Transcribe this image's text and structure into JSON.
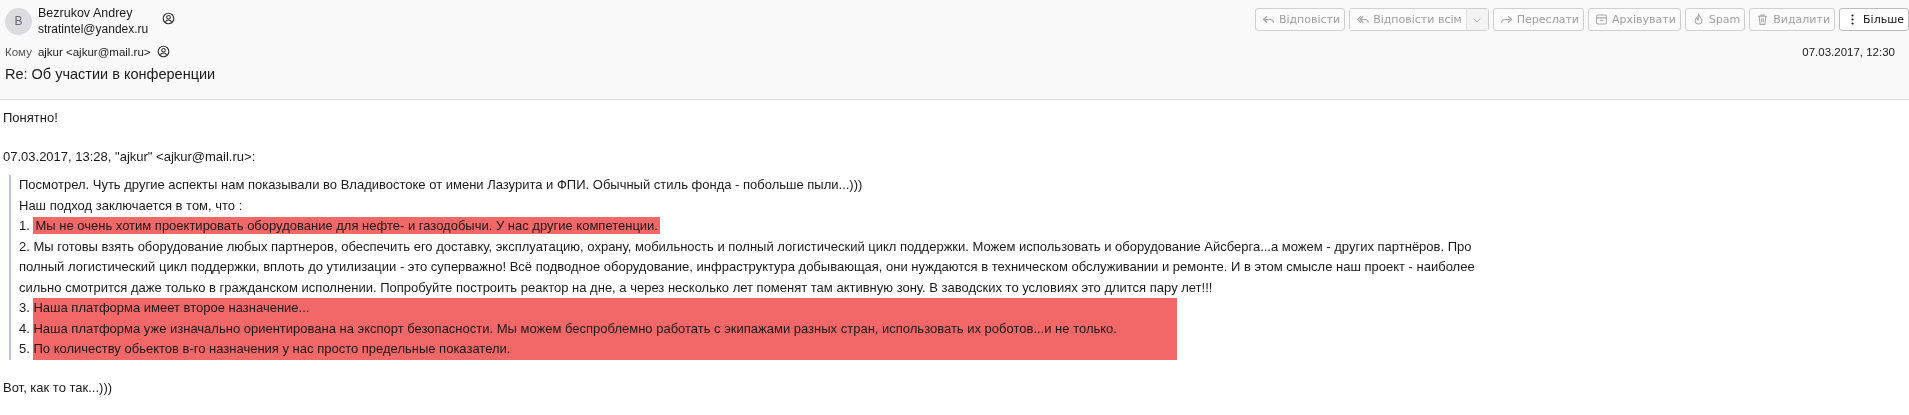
{
  "sender": {
    "avatar_letter": "B",
    "name": "Bezrukov Andrey",
    "email": "stratintel@yandex.ru"
  },
  "toolbar": [
    {
      "kind": "reply",
      "label": "Відповісти",
      "disabled": true
    },
    {
      "kind": "reply-all",
      "label": "Відповісти всім",
      "disabled": true,
      "has_menu": true
    },
    {
      "kind": "forward",
      "label": "Переслати",
      "disabled": true
    },
    {
      "kind": "archive",
      "label": "Архівувати",
      "disabled": true
    },
    {
      "kind": "spam",
      "label": "Spam",
      "disabled": true
    },
    {
      "kind": "delete",
      "label": "Видалити",
      "disabled": true
    },
    {
      "kind": "more",
      "label": "Більше",
      "disabled": false
    }
  ],
  "recipient": {
    "label": "Кому",
    "value": "ajkur <ajkur@mail.ru>"
  },
  "date": "07.03.2017, 12:30",
  "subject": "Re: Об участии в конференции",
  "body": {
    "greeting": "Понятно!",
    "attribution": "07.03.2017, 13:28, \"ajkur\" <ajkur@mail.ru>:",
    "quote": [
      {
        "text": "Посмотрел. Чуть другие аспекты нам показывали во Владивостоке от имени Лазурита и ФПИ. Обычный стиль фонда - побольше пыли...)))",
        "highlighted": false
      },
      {
        "text": "Наш подход заключается в том, что :",
        "highlighted": false
      },
      {
        "number": "1.",
        "text": "Мы не очень хотим проектировать оборудование для нефте- и газодобычи. У нас другие компетенции.",
        "highlighted": true
      },
      {
        "number": "2.",
        "text": "Мы готовы взять оборудование любых партнеров, обеспечить его доставку, эксплуатацию, охрану, мобильность и полный логистический цикл поддержки. Можем использовать и оборудование Айсберга...а можем - других партнёров. Про полный логистический цикл поддержки, вплоть до утилизации - это суперважно! Всё подводное оборудование, инфраструктура добывающая, они нуждаются в техническом обслуживании и ремонте. И в этом смысле наш проект - наиболее сильно смотрится даже только в гражданском исполнении. Попробуйте построить реактор на дне, а через несколько лет поменят  там активную зону. В заводских то условиях это длится пару лет!!!",
        "highlighted": false
      },
      {
        "number": "3.",
        "text": "Наша платформа имеет второе назначение...",
        "highlighted": true
      },
      {
        "number": "4.",
        "text": "Наша платформа уже изначально ориентирована на экспорт безопасности. Мы можем беспроблемно работать с экипажами разных стран, использовать их роботов...и не только.",
        "highlighted": true
      },
      {
        "number": "5.",
        "text": "По количеству обьектов в-го назначения у нас просто предельные показатели.",
        "highlighted": true
      }
    ],
    "closing": "Вот, как то так...)))"
  }
}
